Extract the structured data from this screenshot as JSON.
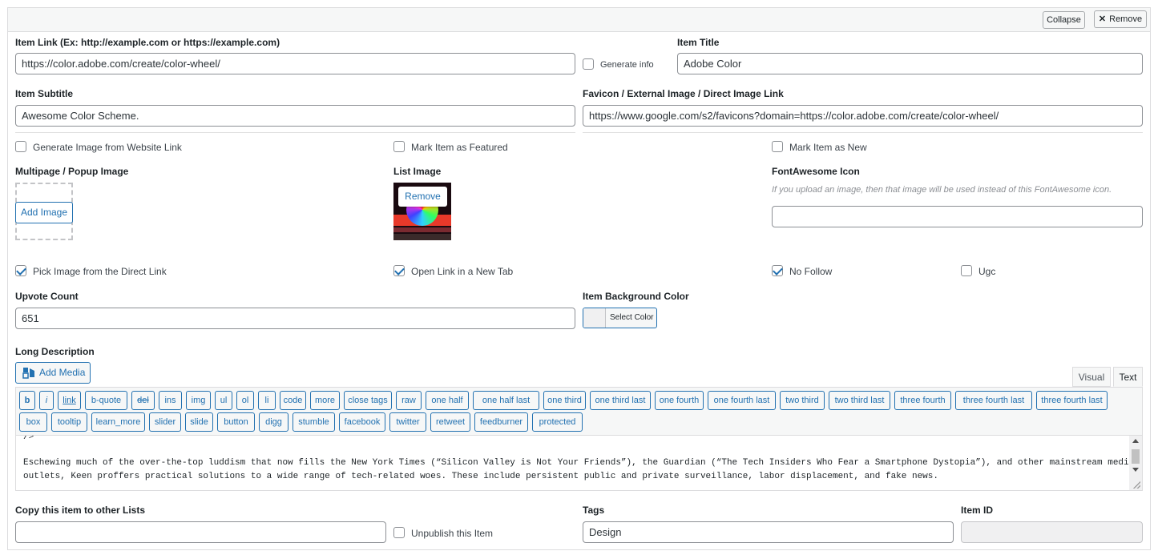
{
  "header": {
    "collapse_label": "Collapse",
    "remove_label": "Remove"
  },
  "item_link": {
    "label": "Item Link (Ex: http://example.com or https://example.com)",
    "value": "https://color.adobe.com/create/color-wheel/"
  },
  "generate_info": {
    "label": "Generate info",
    "checked": false
  },
  "item_title": {
    "label": "Item Title",
    "value": "Adobe Color"
  },
  "item_subtitle": {
    "label": "Item Subtitle",
    "value": "Awesome Color Scheme."
  },
  "favicon": {
    "label": "Favicon / External Image / Direct Image Link",
    "value": "https://www.google.com/s2/favicons?domain=https://color.adobe.com/create/color-wheel/"
  },
  "checks_row1": [
    {
      "label": "Generate Image from Website Link",
      "checked": false
    },
    {
      "label": "Mark Item as Featured",
      "checked": false
    },
    {
      "label": "Mark Item as New",
      "checked": false
    }
  ],
  "multipage_image": {
    "label": "Multipage / Popup Image",
    "button": "Add Image"
  },
  "list_image": {
    "label": "List Image",
    "remove_label": "Remove"
  },
  "fontawesome": {
    "label": "FontAwesome Icon",
    "hint": "If you upload an image, then that image will be used instead of this FontAwesome icon.",
    "value": ""
  },
  "checks_row2": [
    {
      "label": "Pick Image from the Direct Link",
      "checked": true
    },
    {
      "label": "Open Link in a New Tab",
      "checked": true
    },
    {
      "label": "No Follow",
      "checked": true
    },
    {
      "label": "Ugc",
      "checked": false
    }
  ],
  "upvote": {
    "label": "Upvote Count",
    "value": "651"
  },
  "bg_color": {
    "label": "Item Background Color",
    "button": "Select Color"
  },
  "long_desc": {
    "label": "Long Description",
    "add_media": "Add Media",
    "tabs": [
      "Visual",
      "Text"
    ],
    "quicktags_row1": [
      "b",
      "i",
      "link",
      "b-quote",
      "del",
      "ins",
      "img",
      "ul",
      "ol",
      "li",
      "code",
      "more",
      "close tags",
      "raw",
      "one half",
      "one half last",
      "one third",
      "one third last",
      "one fourth",
      "one fourth last",
      "two third",
      "two third last",
      "three fourth",
      "three fourth last",
      "three fourth last"
    ],
    "quicktags_row2": [
      "box",
      "tooltip",
      "learn_more",
      "slider",
      "slide",
      "button",
      "digg",
      "stumble",
      "facebook",
      "twitter",
      "retweet",
      "feedburner",
      "protected"
    ],
    "content_line0": "/>",
    "content_line1": "Eschewing much of the over-the-top luddism that now fills the New York Times (“Silicon Valley is Not Your Friends”), the Guardian (“The Tech Insiders Who Fear a Smartphone Dystopia”), and other mainstream media",
    "content_line2": "outlets, Keen proffers practical solutions to a wide range of tech-related woes. These include persistent public and private surveillance, labor displacement, and fake news."
  },
  "copy_lists": {
    "label": "Copy this item to other Lists",
    "value": ""
  },
  "unpublish": {
    "label": "Unpublish this Item",
    "checked": false
  },
  "tags": {
    "label": "Tags",
    "value": "Design"
  },
  "item_id": {
    "label": "Item ID",
    "value": ""
  },
  "colors": {
    "accent": "#2271b1",
    "border": "#8c8f94"
  }
}
